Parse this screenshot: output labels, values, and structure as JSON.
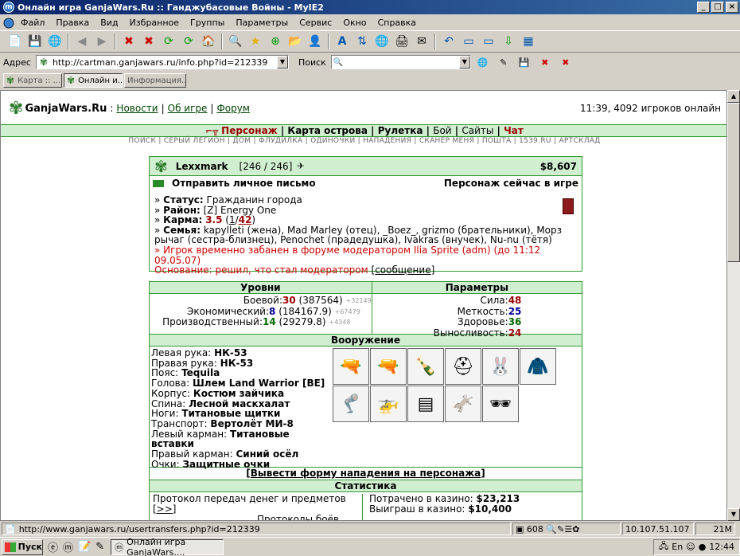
{
  "window": {
    "title": "Онлайн игра GanjaWars.Ru :: Ганджубасовые Войны - MyIE2"
  },
  "menu": [
    "Файл",
    "Правка",
    "Вид",
    "Избранное",
    "Группы",
    "Параметры",
    "Сервис",
    "Окно",
    "Справка"
  ],
  "address": {
    "label": "Адрес",
    "url": "http://cartman.ganjawars.ru/info.php?id=212339",
    "search_label": "Поиск"
  },
  "tabs": [
    "Карта :: ...",
    "Онлайн и...",
    "Информация..."
  ],
  "site": {
    "logo": "GanjaWars.Ru",
    "logo_sep": ":",
    "links": [
      "Новости",
      "Об игре",
      "Форум"
    ],
    "online": "11:39, 4092 игроков онлайн",
    "nav": [
      "Персонаж",
      "Карта острова",
      "Рулетка",
      "Бой",
      "Сайты",
      "Чат"
    ],
    "subnav": "ПОИСК | СЕРЫЙ ЛЕГИОН | ДОМ | ФЛУДИЛКА | ОДИНОЧКИ | НАПАДЕНИЯ | СКАНЕР МЕНЯ | ПОШТА | 1539.RU | АРТСКЛАД"
  },
  "player": {
    "name": "Lexxmark",
    "hp": "[246 / 246]",
    "money": "$8,607",
    "send_mail": "Отправить личное письмо",
    "online_status": "Персонаж сейчас в игре",
    "status_label": "Статус:",
    "status": "Гражданин города",
    "district_label": "Район:",
    "district": "[Z] Energy One",
    "karma_label": "Карма:",
    "karma": "3.5",
    "karma_a": "1",
    "karma_b": "42",
    "family_label": "Семья:",
    "family": "kapylleti (жена), Mad Marley (отец), _Boez_, grizmo (брательники), Морз рычаг (сестра-близнец), Penochet (прадедушка), Ivakras (внучек), Nu-nu (тётя)",
    "ban": "Игрок временно забанен в форуме модератором Ilia Sprite (adm) (до 11:12 09.05.07)",
    "reason": "Основание: решил, что стал модератором",
    "reason_link": "сообщение"
  },
  "levels": {
    "header": "Уровни",
    "rows": [
      {
        "label": "Боевой:",
        "value": "30",
        "exp": "(387564)",
        "diff": "+32149"
      },
      {
        "label": "Экономический:",
        "value": "8",
        "exp": "(184167.9)",
        "diff": "+67479"
      },
      {
        "label": "Производственный:",
        "value": "14",
        "exp": "(29279.8)",
        "diff": "+4348"
      }
    ]
  },
  "params": {
    "header": "Параметры",
    "rows": [
      {
        "label": "Сила:",
        "value": "48"
      },
      {
        "label": "Меткость:",
        "value": "25"
      },
      {
        "label": "Здоровье:",
        "value": "36"
      },
      {
        "label": "Выносливость:",
        "value": "24"
      }
    ]
  },
  "weapons": {
    "header": "Вооружение",
    "items": [
      {
        "slot": "Левая рука:",
        "name": "НК-53"
      },
      {
        "slot": "Правая рука:",
        "name": "НК-53"
      },
      {
        "slot": "Пояс:",
        "name": "Tequila"
      },
      {
        "slot": "Голова:",
        "name": "Шлем Land Warrior [BE]"
      },
      {
        "slot": "Корпус:",
        "name": "Костюм зайчика"
      },
      {
        "slot": "Спина:",
        "name": "Лесной маскхалат"
      },
      {
        "slot": "Ноги:",
        "name": "Титановые щитки"
      },
      {
        "slot": "Транспорт:",
        "name": "Вертолёт МИ-8"
      },
      {
        "slot": "Левый карман:",
        "name": "Титановые вставки"
      },
      {
        "slot": "Правый карман:",
        "name": "Синий осёл"
      },
      {
        "slot": "Очки:",
        "name": "Защитные очки"
      }
    ]
  },
  "attack_link": "Вывести форму нападения на персонажа",
  "stats": {
    "header": "Статистика",
    "left": [
      "Протокол передач денег и предметов",
      "Протоколы боёв"
    ],
    "more": "[>>]",
    "spent_label": "Потрачено в казино:",
    "spent": "$23,213",
    "won_label": "Выиграш в казино:",
    "won": "$10,400"
  },
  "statusbar": {
    "url": "http://www.ganjawars.ru/usertransfers.php?id=212339",
    "count": "608",
    "ip": "10.107.51.107",
    "mem": "21M"
  },
  "taskbar": {
    "start": "Пуск",
    "task": "Онлайн игра GanjaWars....",
    "lang": "En",
    "clock": "12:44"
  }
}
